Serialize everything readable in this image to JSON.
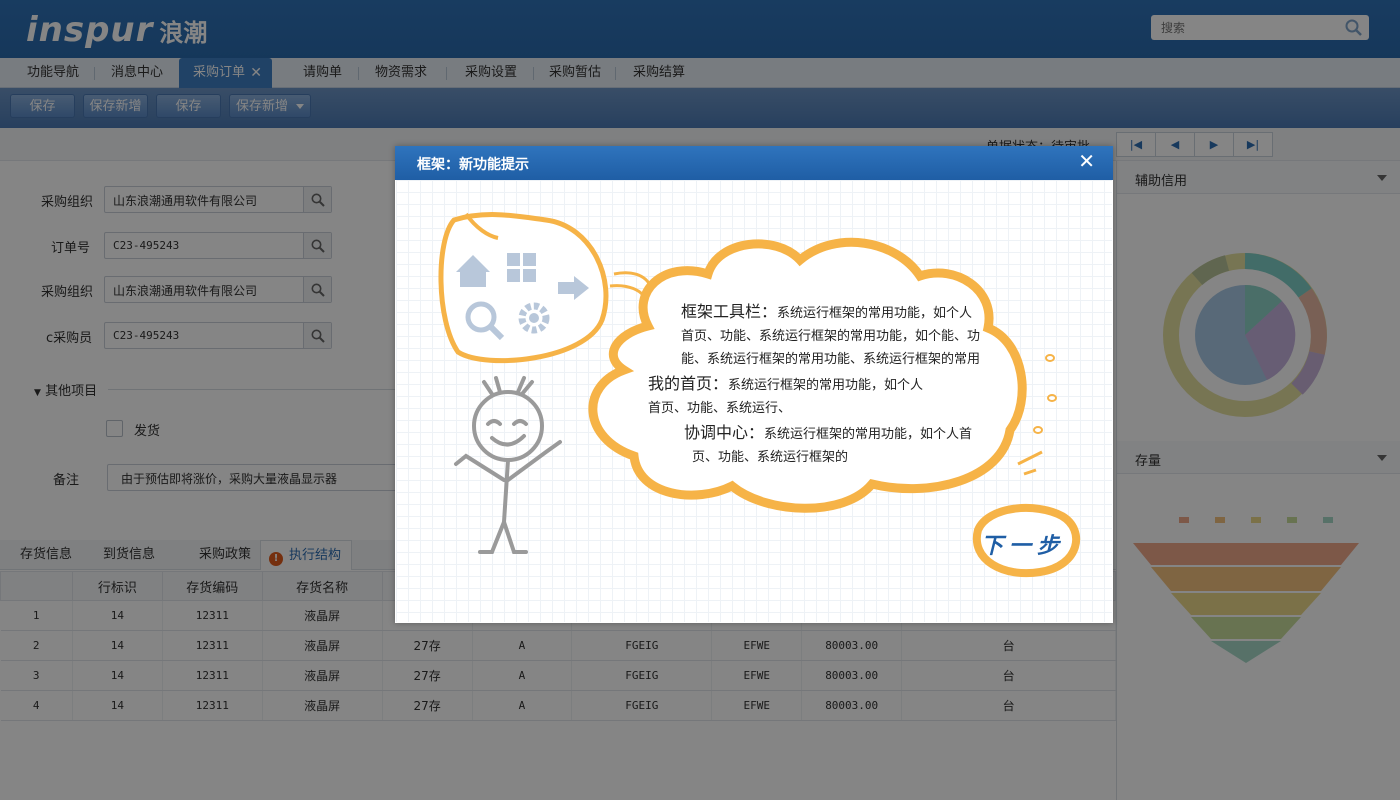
{
  "header": {
    "logo_en": "inspur",
    "logo_cn": "浪潮",
    "search_placeholder": "搜索"
  },
  "nav": {
    "items": [
      "功能导航",
      "消息中心",
      "采购订单",
      "请购单",
      "物资需求",
      "采购设置",
      "采购暂估",
      "采购结算"
    ],
    "close_glyph": "✕"
  },
  "toolbar": {
    "buttons": [
      "保存",
      "保存新增",
      "保存",
      "保存新增"
    ]
  },
  "status": {
    "text": "单据状态：待审批"
  },
  "form": {
    "fields": [
      {
        "label": "采购组织",
        "value": "山东浪潮通用软件有限公司"
      },
      {
        "label": "订单号",
        "value": "C23-495243"
      },
      {
        "label": "采购组织",
        "value": "山东浪潮通用软件有限公司"
      },
      {
        "label": "c采购员",
        "value": "C23-495243"
      }
    ],
    "section_title": "其他项目",
    "checkbox_label": "发货",
    "remark_label": "备注",
    "remark_value": "由于预估即将涨价，采购大量液晶显示器"
  },
  "bottom_tabs": {
    "items": [
      "存货信息",
      "到货信息",
      "采购政策",
      "执行结构"
    ],
    "warn_glyph": "!"
  },
  "table": {
    "headers": [
      "",
      "行标识",
      "存货编码",
      "存货名称",
      "",
      "",
      "",
      "",
      "",
      ""
    ],
    "rows": [
      [
        "1",
        "14",
        "12311",
        "液晶屏",
        "",
        "",
        "",
        "",
        "",
        ""
      ],
      [
        "2",
        "14",
        "12311",
        "液晶屏",
        "27存",
        "A",
        "FGEIG",
        "EFWE",
        "80003.00",
        "台"
      ],
      [
        "3",
        "14",
        "12311",
        "液晶屏",
        "27存",
        "A",
        "FGEIG",
        "EFWE",
        "80003.00",
        "台"
      ],
      [
        "4",
        "14",
        "12311",
        "液晶屏",
        "27存",
        "A",
        "FGEIG",
        "EFWE",
        "80003.00",
        "台"
      ]
    ]
  },
  "right_panel": {
    "panel1_title": "辅助信用",
    "panel2_title": "存量"
  },
  "modal": {
    "title": "框架：新功能提示",
    "close": "✕",
    "blocks": [
      {
        "heading": "框架工具栏：",
        "lines": [
          "系统运行框架的常用功能，如个人",
          "首页、功能、系统运行框架的常用功能，如个能、功",
          "能、系统运行框架的常用功能、系统运行框架的常用"
        ]
      },
      {
        "heading": "我的首页：",
        "lines": [
          "系统运行框架的常用功能，如个人",
          "首页、功能、系统运行、"
        ]
      },
      {
        "heading": "协调中心：",
        "lines": [
          "系统运行框架的常用功能，如个人首",
          "页、功能、系统运行框架的"
        ]
      }
    ],
    "next_label": "下一步"
  },
  "colors": {
    "brand_blue": "#2a6aad",
    "accent_orange": "#f6b347",
    "link_blue": "#1f5ea5"
  }
}
